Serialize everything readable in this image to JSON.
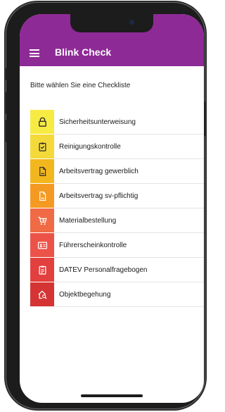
{
  "app": {
    "title": "Blink Check",
    "accent_color": "#8e2a96"
  },
  "screen": {
    "prompt": "Bitte wählen Sie eine Checkliste"
  },
  "checklists": [
    {
      "label": "Sicherheitsunterweisung",
      "icon": "lock-icon",
      "color": "#f7ea43",
      "icon_color": "#2b2b2b"
    },
    {
      "label": "Reinigungskontrolle",
      "icon": "clipboard-check-icon",
      "color": "#f4d93a",
      "icon_color": "#2b2b2b"
    },
    {
      "label": "Arbeitsvertrag gewerblich",
      "icon": "document-image-icon",
      "color": "#f2b71e",
      "icon_color": "#2b2b2b"
    },
    {
      "label": "Arbeitsvertrag sv-pflichtig",
      "icon": "document-image-icon",
      "color": "#f49a22",
      "icon_color": "#ffffff"
    },
    {
      "label": "Materialbestellung",
      "icon": "cart-icon",
      "color": "#f06a45",
      "icon_color": "#ffffff"
    },
    {
      "label": "Führerscheinkontrolle",
      "icon": "id-card-icon",
      "color": "#ec5348",
      "icon_color": "#ffffff"
    },
    {
      "label": "DATEV Personalfragebogen",
      "icon": "clipboard-list-icon",
      "color": "#e2403e",
      "icon_color": "#ffffff"
    },
    {
      "label": "Objektbegehung",
      "icon": "house-search-icon",
      "color": "#d53434",
      "icon_color": "#ffffff"
    }
  ]
}
